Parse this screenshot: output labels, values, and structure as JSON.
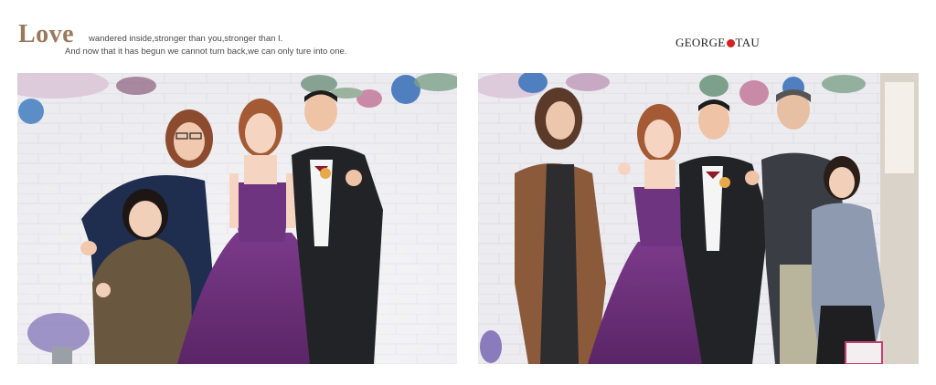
{
  "header": {
    "title": "Love",
    "tagline_line1": "wandered inside,stronger than you,stronger than I.",
    "tagline_line2": "And now that it has begun we cannot turn back,we can only ture into one.",
    "brand_left": "GEORGE",
    "brand_right": "TAU"
  },
  "photos": [
    {
      "name": "photo-left",
      "subjects": [
        "woman-in-glasses",
        "girl",
        "bride",
        "groom"
      ]
    },
    {
      "name": "photo-right",
      "subjects": [
        "woman-in-leather-jacket",
        "bride",
        "groom",
        "man",
        "girl"
      ]
    }
  ],
  "colors": {
    "title": "#9a7a5e",
    "brand_dot": "#d3221f",
    "gown": "#6b2f7a",
    "backdrop": "#e9e9ee"
  }
}
